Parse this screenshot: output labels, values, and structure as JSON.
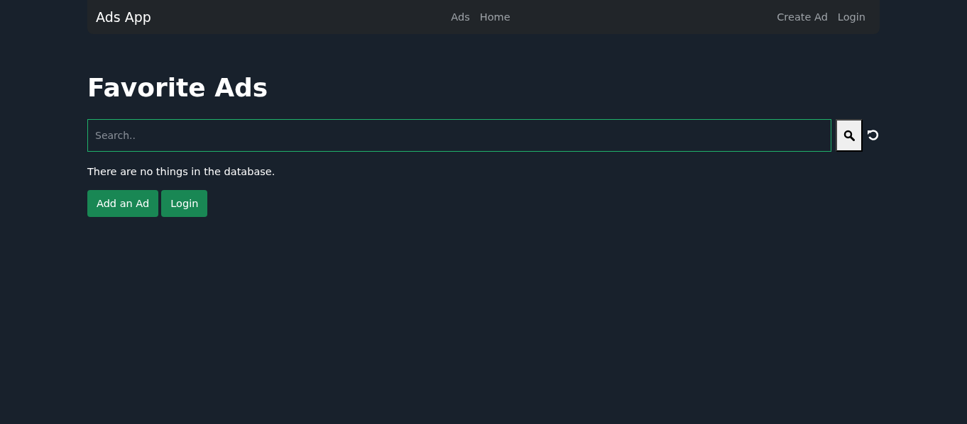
{
  "navbar": {
    "brand": "Ads App",
    "center_links": [
      "Ads",
      "Home"
    ],
    "right_links": [
      "Create Ad",
      "Login"
    ]
  },
  "heading": "Favorite Ads",
  "search": {
    "placeholder": "Search.."
  },
  "message": "There are no things in the database.",
  "buttons": [
    "Add an Ad",
    "Login"
  ]
}
